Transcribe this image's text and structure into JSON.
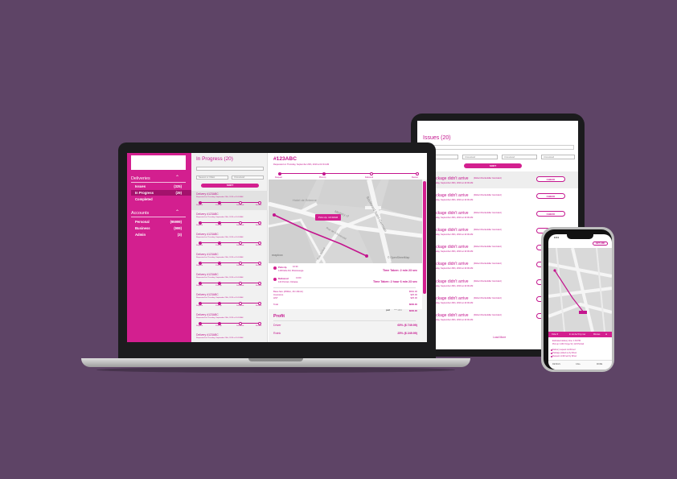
{
  "tablet": {
    "title": "Issues (20)",
    "filters": [
      "Status: All",
      "Unresolved",
      "Unresolved",
      "Unresolved"
    ],
    "sort_label": "SORT",
    "issue_title": "Package didn't arrive",
    "issue_sub": "(Robert Rockefeller Gonzalez)",
    "issue_date": "Thursday, September 26th, 2019 at 10:00 AM",
    "check_label": "CHECK",
    "load_more": "Load More",
    "thumb_label": "aca"
  },
  "laptop": {
    "sidebar": {
      "deliveries_heading": "Deliveries",
      "deliveries": [
        {
          "label": "Issues",
          "count": "(325)"
        },
        {
          "label": "In Progress",
          "count": "(29)"
        },
        {
          "label": "Completed",
          "count": ""
        }
      ],
      "accounts_heading": "Accounts",
      "accounts": [
        {
          "label": "Personal",
          "count": "(95999)"
        },
        {
          "label": "Business",
          "count": "(999)"
        },
        {
          "label": "Admin",
          "count": "(3)"
        }
      ]
    },
    "list": {
      "title": "In Progress (20)",
      "select_a": "Nearest to Oldest",
      "select_b": "Unresolved",
      "sort_label": "SORT",
      "delivery_title": "Delivery #123ABC",
      "delivery_sub": "Requested on Thursday, September 26th, 2019 at 10:34 AM",
      "steps": [
        "Request",
        "Pick-Up",
        "Delivered",
        "Review"
      ]
    },
    "detail": {
      "title": "#123ABC",
      "requested": "Requested on Thursday, September 26th, 2019 at 10:34 AM",
      "steps": [
        "Request",
        "Pick-Up",
        "Delivered",
        "Review"
      ],
      "map_labels": {
        "hotel": "Hotel de Brienne",
        "boulevard": "Boulevard Saint-Germain",
        "ministry": "Ministry of",
        "river": "Rue de l'Université",
        "barbet": "Rue Barbet"
      },
      "pin_label": "Pick-Up: 10:30AM",
      "mapbox": "mapbox",
      "osm": "© OpenStreetMap",
      "events": [
        {
          "name": "Pick-Up",
          "time": "10:30",
          "address": "1400 Elite Rd, Mississauga",
          "taken": "Time Taken: 2 min 23 sec"
        },
        {
          "name": "Delivered",
          "time": "13:00",
          "address": "123 Portrait, Oshawa",
          "taken": "Time Taken: 2 hour 6 min 23 sec"
        }
      ],
      "pricing": {
        "labels": [
          "Base fare (250km, 2hr 20min)",
          "Insurance",
          "HST"
        ],
        "values": [
          "$562.00",
          "$25.00",
          "$25.00"
        ],
        "total_label": "Total",
        "total_value": "$600.00",
        "paid_tag": "paid",
        "paid_sub": "**** 1234",
        "paid_value": "$600.00"
      },
      "profit": {
        "title": "Profit",
        "rows": [
          {
            "label": "Driver",
            "value": "65% ($ 749.99)"
          },
          {
            "label": "Rolnk",
            "value": "25% ($ 249.99)"
          }
        ]
      }
    }
  },
  "phone": {
    "time": "9:41",
    "get_link": "GET LINK",
    "bar_labels": [
      "Order #",
      "In can be 5 by now",
      "Minutes"
    ],
    "lines": [
      "Estimated delivery time: 1:30 PM",
      "Pick up: 1430 Yonge St  |  123 Portrait",
      "Delivery request confirmed",
      "Package picked up by Driver",
      "Request confirmed by Driver"
    ],
    "footer": [
      "DETAILS",
      "CALL",
      "MORE"
    ]
  }
}
